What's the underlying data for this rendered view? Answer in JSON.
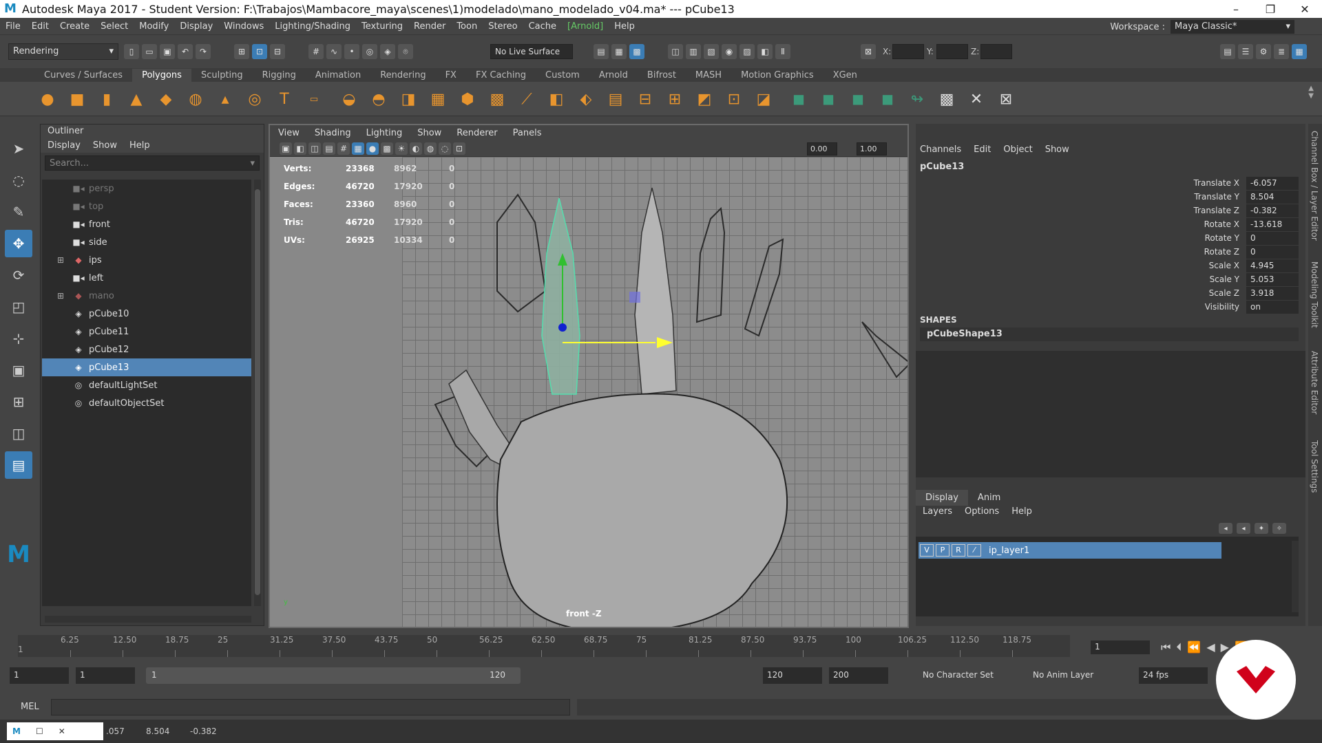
{
  "window": {
    "title": "Autodesk Maya 2017 - Student Version: F:\\Trabajos\\Mambacore_maya\\scenes\\1)modelado\\mano_modelado_v04.ma*   ---   pCube13",
    "minimize": "–",
    "restore": "❐",
    "close": "✕"
  },
  "menu": [
    "File",
    "Edit",
    "Create",
    "Select",
    "Modify",
    "Display",
    "Windows",
    "Lighting/Shading",
    "Texturing",
    "Render",
    "Toon",
    "Stereo",
    "Cache",
    "[Arnold]",
    "Help"
  ],
  "workspace": {
    "label": "Workspace :",
    "value": "Maya Classic*"
  },
  "status": {
    "menuset": "Rendering",
    "live_surface": "No Live Surface",
    "x_label": "X:",
    "y_label": "Y:",
    "z_label": "Z:"
  },
  "shelf_tabs": [
    "Curves / Surfaces",
    "Polygons",
    "Sculpting",
    "Rigging",
    "Animation",
    "Rendering",
    "FX",
    "FX Caching",
    "Custom",
    "Arnold",
    "Bifrost",
    "MASH",
    "Motion Graphics",
    "XGen"
  ],
  "outliner": {
    "title": "Outliner",
    "menu": [
      "Display",
      "Show",
      "Help"
    ],
    "search_placeholder": "Search...",
    "items": [
      {
        "label": "persp",
        "icon": "camera-icon",
        "dim": true
      },
      {
        "label": "top",
        "icon": "camera-icon",
        "dim": true
      },
      {
        "label": "front",
        "icon": "camera-icon",
        "dim": false
      },
      {
        "label": "side",
        "icon": "camera-icon",
        "dim": false
      },
      {
        "label": "ips",
        "icon": "group-icon",
        "dim": false,
        "expand": true
      },
      {
        "label": "left",
        "icon": "camera-icon",
        "dim": false
      },
      {
        "label": "mano",
        "icon": "group-icon",
        "dim": true,
        "expand": true
      },
      {
        "label": "pCube10",
        "icon": "mesh-icon",
        "dim": false
      },
      {
        "label": "pCube11",
        "icon": "mesh-icon",
        "dim": false
      },
      {
        "label": "pCube12",
        "icon": "mesh-icon",
        "dim": false
      },
      {
        "label": "pCube13",
        "icon": "mesh-icon",
        "dim": false,
        "selected": true
      },
      {
        "label": "defaultLightSet",
        "icon": "set-icon",
        "dim": false
      },
      {
        "label": "defaultObjectSet",
        "icon": "set-icon",
        "dim": false
      }
    ]
  },
  "viewport": {
    "menu": [
      "View",
      "Shading",
      "Lighting",
      "Show",
      "Renderer",
      "Panels"
    ],
    "field1": "0.00",
    "field2": "1.00",
    "camera": "front -Z",
    "hud": [
      {
        "label": "Verts:",
        "v1": "23368",
        "v2": "8962",
        "v3": "0"
      },
      {
        "label": "Edges:",
        "v1": "46720",
        "v2": "17920",
        "v3": "0"
      },
      {
        "label": "Faces:",
        "v1": "23360",
        "v2": "8960",
        "v3": "0"
      },
      {
        "label": "Tris:",
        "v1": "46720",
        "v2": "17920",
        "v3": "0"
      },
      {
        "label": "UVs:",
        "v1": "26925",
        "v2": "10334",
        "v3": "0"
      }
    ]
  },
  "channelbox": {
    "menu": [
      "Channels",
      "Edit",
      "Object",
      "Show"
    ],
    "object": "pCube13",
    "attrs": [
      {
        "name": "Translate X",
        "value": "-6.057"
      },
      {
        "name": "Translate Y",
        "value": "8.504"
      },
      {
        "name": "Translate Z",
        "value": "-0.382"
      },
      {
        "name": "Rotate X",
        "value": "-13.618"
      },
      {
        "name": "Rotate Y",
        "value": "0"
      },
      {
        "name": "Rotate Z",
        "value": "0"
      },
      {
        "name": "Scale X",
        "value": "4.945"
      },
      {
        "name": "Scale Y",
        "value": "5.053"
      },
      {
        "name": "Scale Z",
        "value": "3.918"
      },
      {
        "name": "Visibility",
        "value": "on"
      }
    ],
    "shapes_label": "SHAPES",
    "shape": "pCubeShape13",
    "layer_tabs": [
      "Display",
      "Anim"
    ],
    "layer_menu": [
      "Layers",
      "Options",
      "Help"
    ],
    "layer": {
      "v": "V",
      "p": "P",
      "r": "R",
      "name": "ip_layer1"
    }
  },
  "sidetabs": [
    "Channel Box / Layer Editor",
    "Modeling Toolkit",
    "Attribute Editor",
    "Tool Settings"
  ],
  "timeline": {
    "ticks": [
      "6.25",
      "12.50",
      "18.75",
      "25",
      "31.25",
      "37.50",
      "43.75",
      "50",
      "56.25",
      "62.50",
      "68.75",
      "75",
      "81.25",
      "87.50",
      "93.75",
      "100",
      "106.25",
      "112.50",
      "118.75"
    ],
    "start_tick": "1",
    "current": "1"
  },
  "range": {
    "start": "1",
    "playstart": "1",
    "slider_start": "1",
    "slider_end": "120",
    "end": "120",
    "maxend": "200",
    "character": "No Character Set",
    "anim_layer": "No Anim Layer",
    "fps": "24 fps"
  },
  "cmd": {
    "label": "MEL"
  },
  "helpline": {
    "v1": ".057",
    "v2": "8.504",
    "v3": "-0.382"
  }
}
